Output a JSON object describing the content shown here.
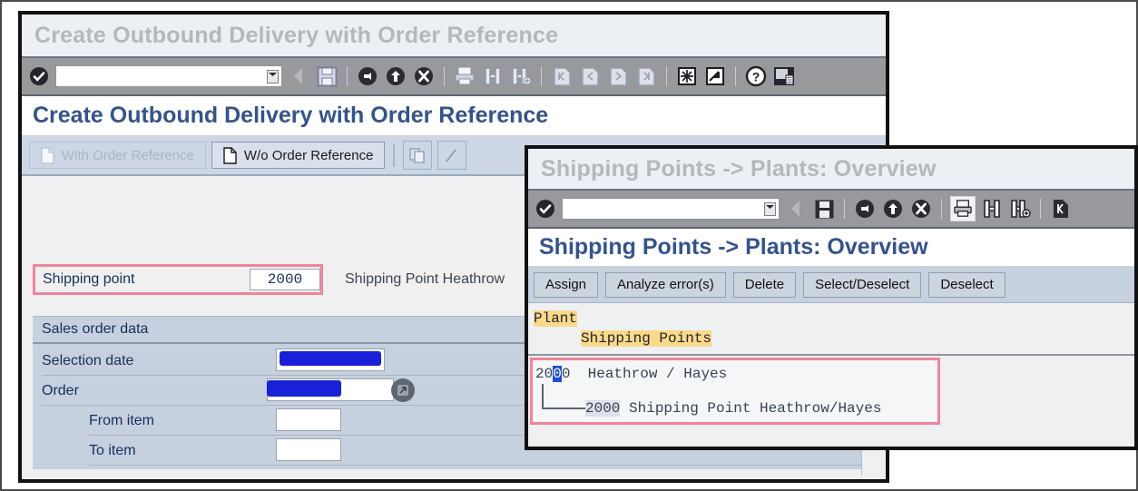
{
  "window_create": {
    "title_bar": "Create Outbound Delivery with Order Reference",
    "screen_title": "Create Outbound Delivery with Order Reference",
    "command_field": {
      "value": "",
      "placeholder": ""
    },
    "toolbar_icons": [
      "enter-check-icon",
      "back-arrow-icon",
      "save-disk-icon",
      "exit-back-icon",
      "exit-up-icon",
      "cancel-x-icon",
      "print-icon",
      "find-icon",
      "find-next-icon",
      "first-page-icon",
      "previous-page-icon",
      "next-page-icon",
      "last-page-icon",
      "create-session-icon",
      "create-shortcut-icon",
      "help-icon",
      "customize-layout-icon"
    ],
    "tabs": [
      {
        "label": "With Order Reference",
        "state": "disabled",
        "icon": "document-icon"
      },
      {
        "label": "W/o Order Reference",
        "state": "active",
        "icon": "document-icon"
      }
    ],
    "extra_buttons": [
      "copy-icon",
      "partial-icon"
    ],
    "shipping_point": {
      "label": "Shipping point",
      "value": "2000",
      "description": "Shipping Point Heathrow",
      "highlighted": true
    },
    "group": {
      "title": "Sales order data",
      "fields": [
        {
          "label": "Selection date",
          "value": "",
          "redacted": true,
          "has_f4": false
        },
        {
          "label": "Order",
          "value": "",
          "redacted": true,
          "has_f4": true
        },
        {
          "label": "From item",
          "value": "",
          "redacted": false,
          "has_f4": false
        },
        {
          "label": "To item",
          "value": "",
          "redacted": false,
          "has_f4": false
        }
      ]
    }
  },
  "window_shipping": {
    "title_bar": "Shipping Points -> Plants: Overview",
    "screen_title": "Shipping Points -> Plants: Overview",
    "command_field": {
      "value": "",
      "placeholder": ""
    },
    "toolbar_icons": [
      "enter-check-icon",
      "back-arrow-icon",
      "save-disk-icon",
      "exit-back-icon",
      "exit-up-icon",
      "cancel-x-icon",
      "print-icon",
      "find-icon",
      "find-next-icon",
      "first-page-icon"
    ],
    "buttons": [
      {
        "label": "Assign"
      },
      {
        "label": "Analyze error(s)"
      },
      {
        "label": "Delete"
      },
      {
        "label": "Select/Deselect"
      },
      {
        "label": "Deselect"
      }
    ],
    "tree_headers": [
      {
        "label": "Plant",
        "indent": 0
      },
      {
        "label": "Shipping Points",
        "indent": 1
      }
    ],
    "tree_nodes": [
      {
        "code_prefix": "20",
        "code_selected": "0",
        "code_suffix": "0",
        "text": "Heathrow / Hayes",
        "indent": 0
      },
      {
        "code": "2000",
        "text": "Shipping Point Heathrow/Hayes",
        "indent": 1
      }
    ],
    "highlighted": true
  },
  "colors": {
    "title_gray": "#b4b7bb",
    "screen_title_blue": "#33538c",
    "toolbar_gray": "#97999c",
    "tabstrip_blue": "#ccd6e4",
    "form_bg": "#eef0f2",
    "group_bg": "#c6d0de",
    "highlight_pink": "#f0849b",
    "tree_header_yellow": "#fbd98a",
    "selection_blue": "#1d4fd8",
    "redaction_blue": "#1820d8"
  }
}
